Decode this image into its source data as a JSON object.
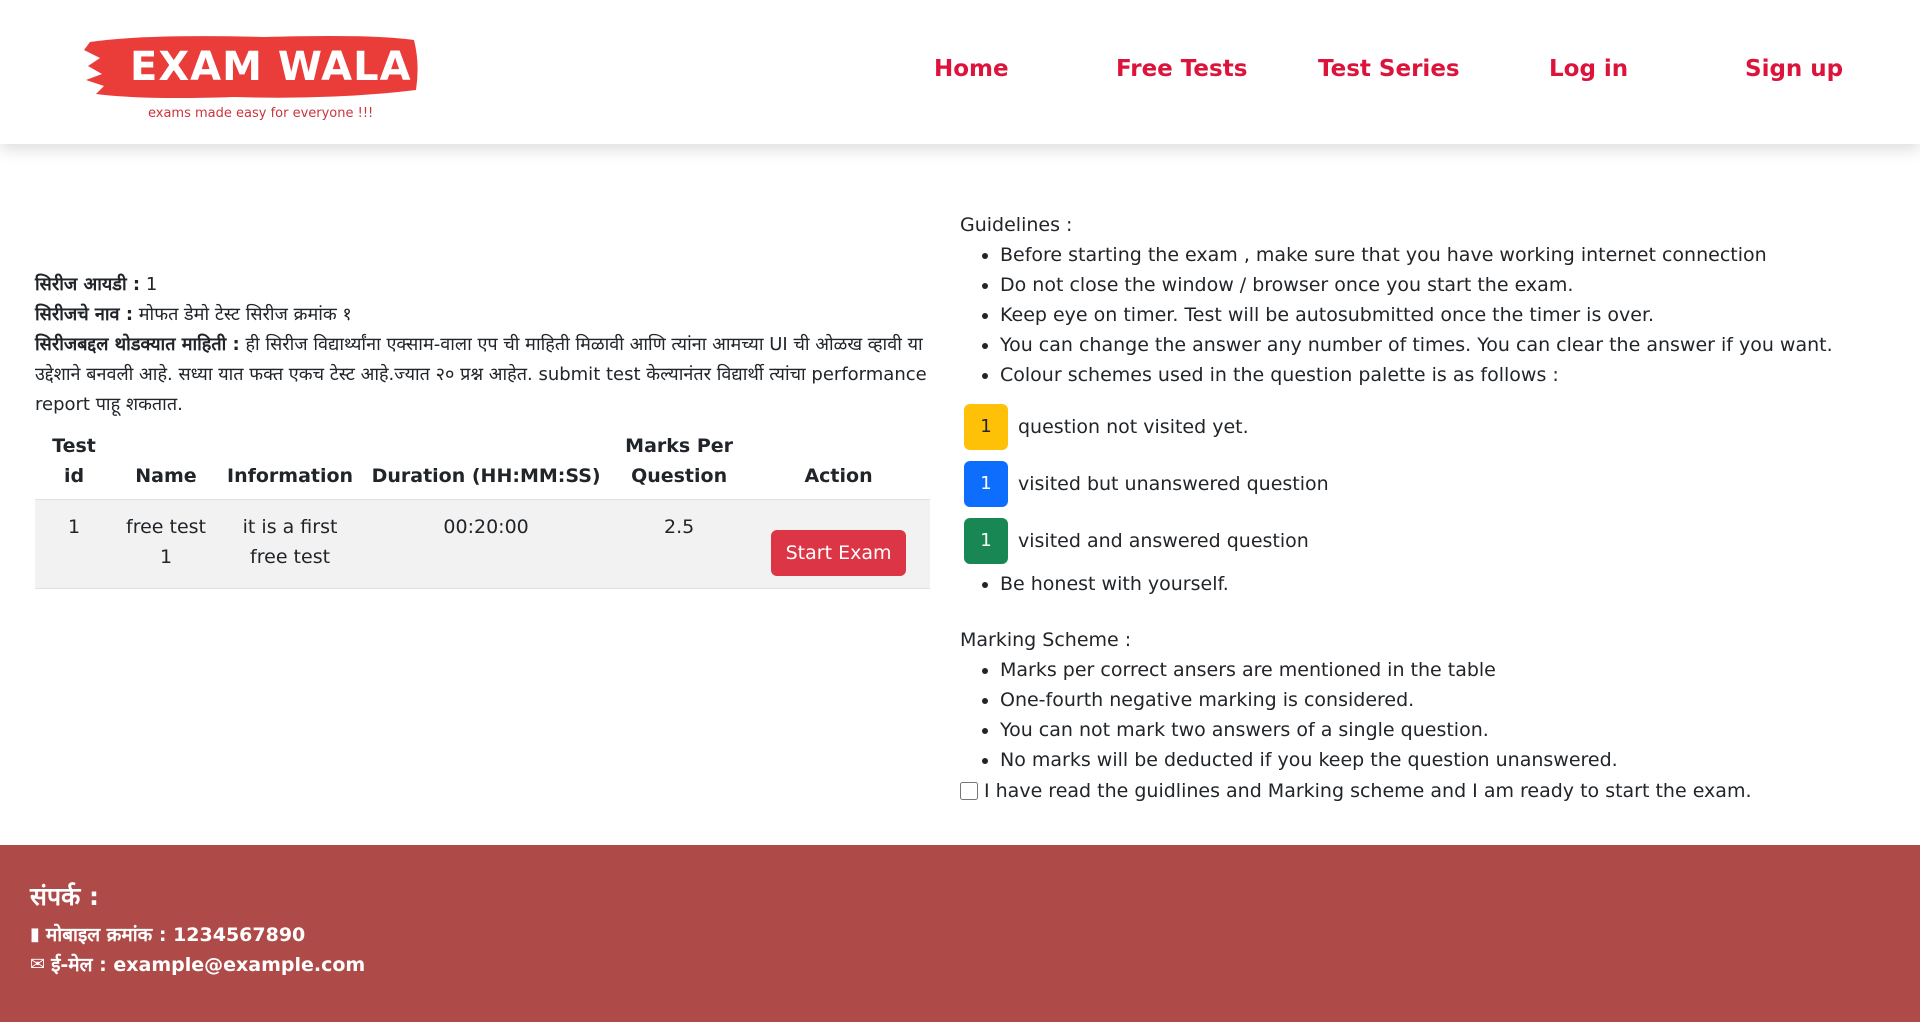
{
  "brand": {
    "name": "EXAM WALA",
    "tagline": "exams made easy for everyone !!!"
  },
  "nav": [
    "Home",
    "Free Tests",
    "Test Series",
    "Log in",
    "Sign up"
  ],
  "series": {
    "id_label": "सिरीज आयडी :",
    "id_value": "1",
    "name_label": "सिरीजचे नाव :",
    "name_value": "मोफत डेमो टेस्ट सिरीज क्रमांक १",
    "about_label": "सिरीजबद्दल थोडक्यात माहिती :",
    "about_value": "ही सिरीज विद्यार्थ्यांना एक्साम-वाला एप ची माहिती मिळावी आणि त्यांना आमच्या UI ची ओळख व्हावी या उद्देशाने बनवली आहे. सध्या यात फक्त एकच टेस्ट आहे.ज्यात २० प्रश्न आहेत. submit test केल्यानंतर विद्यार्थी त्यांचा performance report पाहू शकतात."
  },
  "table": {
    "headers": [
      "Test id",
      "Name",
      "Information",
      "Duration (HH:MM:SS)",
      "Marks Per Question",
      "Action"
    ],
    "rows": [
      {
        "id": "1",
        "name": "free test 1",
        "info": "it is a first free test",
        "duration": "00:20:00",
        "marks": "2.5",
        "action": "Start Exam"
      }
    ]
  },
  "guidelines": {
    "heading": "Guidelines :",
    "items": [
      "Before starting the exam , make sure that you have working internet connection",
      "Do not close the window / browser once you start the exam.",
      "Keep eye on timer. Test will be autosubmitted once the timer is over.",
      "You can change the answer any number of times. You can clear the answer if you want.",
      "Colour schemes used in the question palette is as follows :"
    ],
    "palette": [
      {
        "num": "1",
        "text": "question not visited yet.",
        "color": "#ffc107",
        "fg": "#212529"
      },
      {
        "num": "1",
        "text": "visited but unanswered question",
        "color": "#0d6efd",
        "fg": "#ffffff"
      },
      {
        "num": "1",
        "text": "visited and answered question",
        "color": "#198754",
        "fg": "#ffffff"
      }
    ],
    "last": "Be honest with yourself."
  },
  "marking": {
    "heading": "Marking Scheme :",
    "items": [
      "Marks per correct ansers are mentioned in the table",
      "One-fourth negative marking is considered.",
      "You can not mark two answers of a single question.",
      "No marks will be deducted if you keep the question unanswered."
    ]
  },
  "agree_text": "I have read the guidlines and Marking scheme and I am ready to start the exam.",
  "footer": {
    "title": "संपर्क :",
    "phone": "मोबाइल क्रमांक : 1234567890",
    "email": "ई-मेल : example@example.com"
  },
  "colors": {
    "brand_red": "#ea3d3a",
    "nav": "#dc143c",
    "footer_bg": "#ae4a48",
    "start_btn": "#dc3545"
  }
}
